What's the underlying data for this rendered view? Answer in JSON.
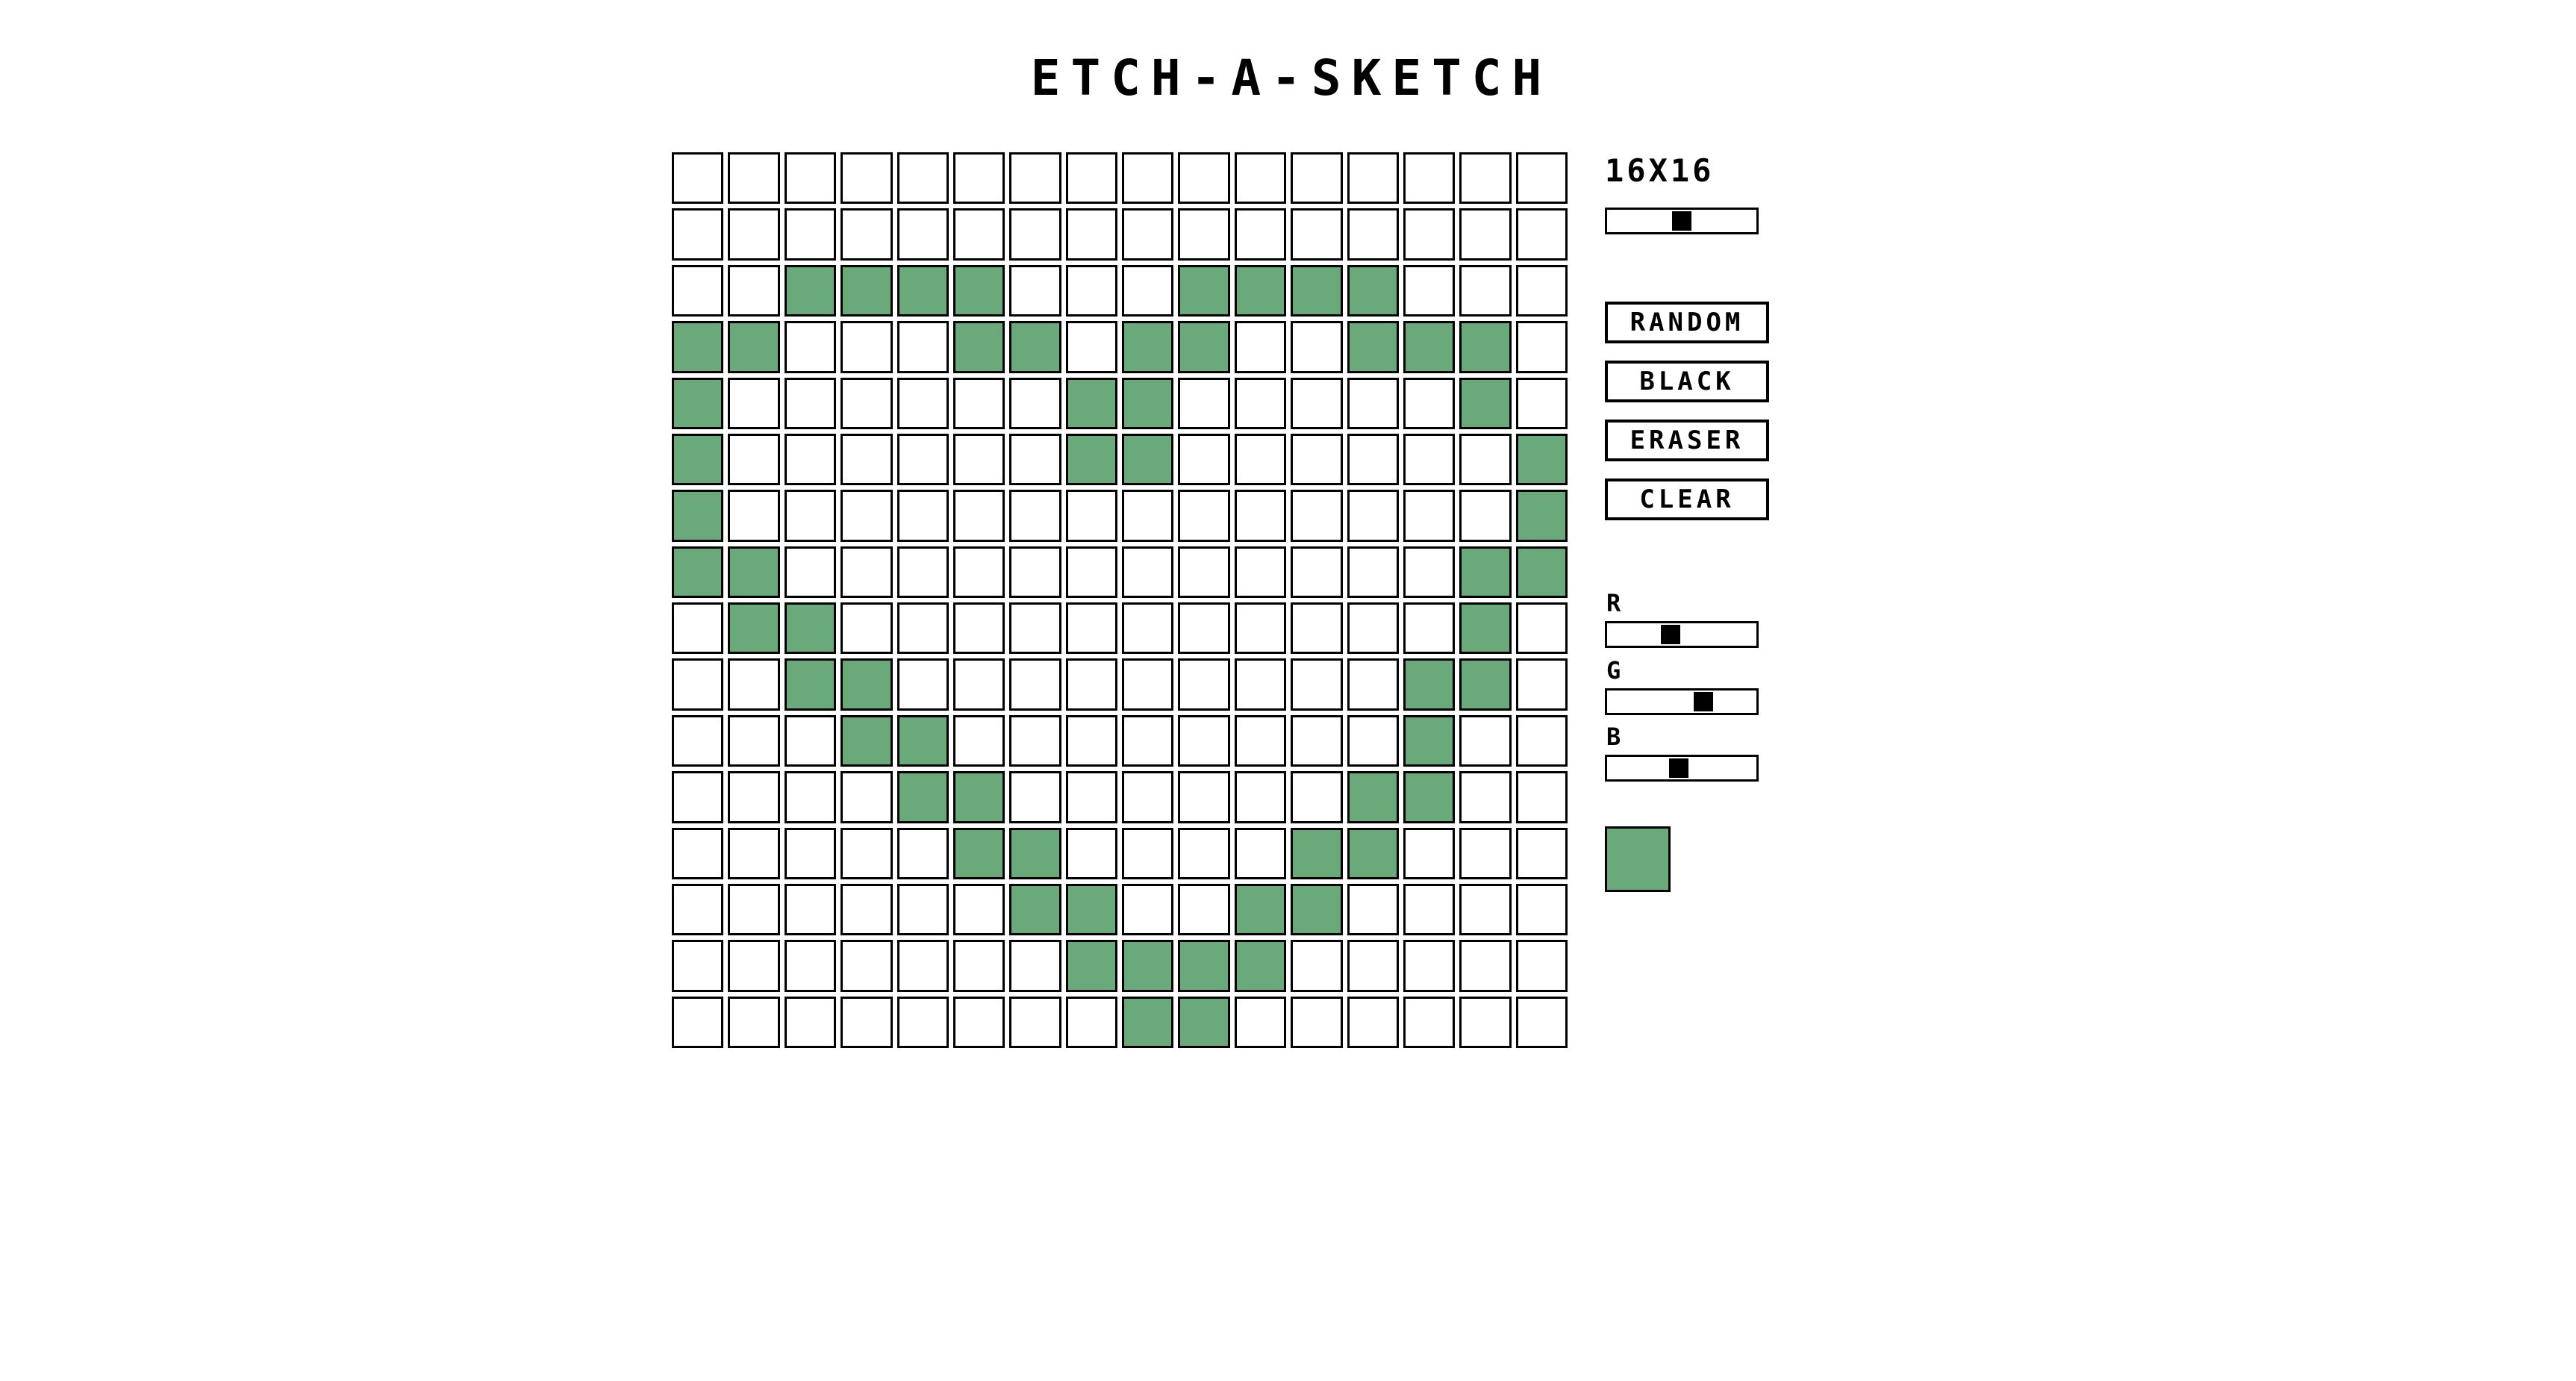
{
  "app": {
    "title": "ETCH-A-SKETCH"
  },
  "grid": {
    "size_label": "16X16",
    "size": 16,
    "size_slider_level": 0.5,
    "fill_color": "#6aaa7a",
    "empty_color": "#ffffff",
    "pattern": [
      "0000000000000000",
      "0000000000000000",
      "0011110001111000",
      "1100011011001110",
      "1000000110000010",
      "1000000110000001",
      "1000000000000001",
      "1100000000000011",
      "0110000000000010",
      "0011000000000110",
      "0001100000000100",
      "0000110000001100",
      "0000011000011000",
      "0000001100110000",
      "0000000111100000",
      "0000000011000000"
    ]
  },
  "controls": {
    "random_label": "RANDOM",
    "black_label": "BLACK",
    "eraser_label": "ERASER",
    "clear_label": "CLEAR"
  },
  "rgb": {
    "r_label": "R",
    "g_label": "G",
    "b_label": "B",
    "r_value": 106,
    "g_value": 170,
    "b_value": 122
  },
  "current_color": "#6aaa7a"
}
